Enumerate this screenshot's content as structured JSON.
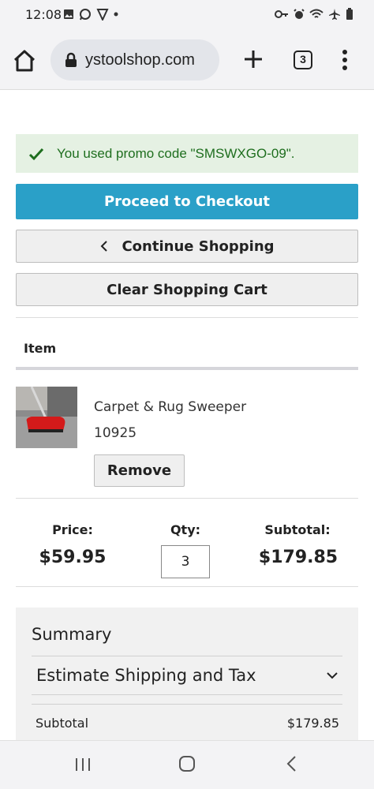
{
  "status_bar": {
    "time": "12:08"
  },
  "browser": {
    "url": "ystoolshop.com",
    "tab_count": "3"
  },
  "promo": {
    "message": "You used promo code \"SMSWXGO-09\"."
  },
  "actions": {
    "checkout_label": "Proceed to Checkout",
    "continue_label": "Continue Shopping",
    "clear_label": "Clear Shopping Cart"
  },
  "cart": {
    "item_header": "Item",
    "product": {
      "name": "Carpet & Rug Sweeper",
      "sku": "10925",
      "remove_label": "Remove"
    },
    "price_label": "Price:",
    "price": "$59.95",
    "qty_label": "Qty:",
    "qty": "3",
    "subtotal_label": "Subtotal:",
    "subtotal": "$179.85"
  },
  "summary": {
    "title": "Summary",
    "shipping_label": "Estimate Shipping and Tax",
    "subtotal_label": "Subtotal",
    "subtotal_value": "$179.85"
  },
  "colors": {
    "primary_button": "#2aa0c8",
    "promo_bg": "#e5f1e3",
    "promo_text": "#1e6e1e"
  }
}
